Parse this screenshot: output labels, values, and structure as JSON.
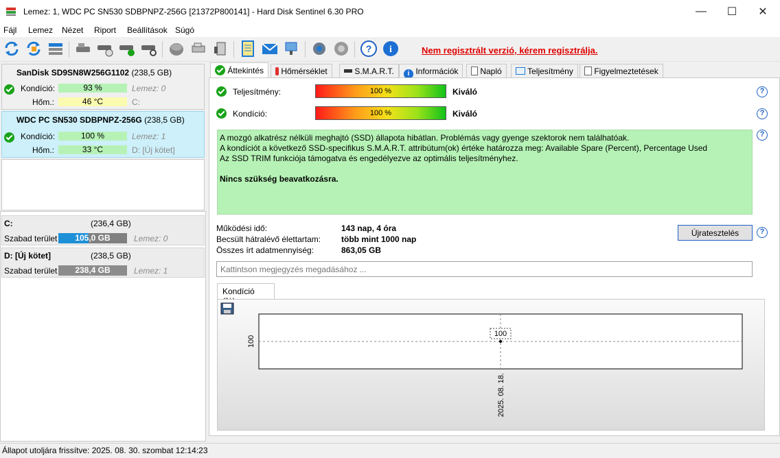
{
  "window": {
    "title": "Lemez: 1, WDC PC SN530 SDBPNPZ-256G [21372P800141]  -  Hard Disk Sentinel 6.30 PRO",
    "minimize": "—",
    "maximize": "☐",
    "close": "✕"
  },
  "menu": [
    "Fájl",
    "Lemez",
    "Nézet",
    "Riport",
    "Beállítások",
    "Súgó"
  ],
  "toolbar": {
    "register_link": "Nem regisztrált verzió, kérem regisztrálja."
  },
  "disks": [
    {
      "name": "SanDisk SD9SN8W256G1102",
      "size": "(238,5 GB)",
      "condition_label": "Kondíció:",
      "condition": "93 %",
      "condition_fraction": 0.93,
      "disk_ref": "Lemez: 0",
      "temp_label": "Hőm.:",
      "temp": "46 °C",
      "volumes": "C:"
    },
    {
      "name": "WDC PC SN530 SDBPNPZ-256G",
      "size": "(238,5 GB)",
      "condition_label": "Kondíció:",
      "condition": "100 %",
      "condition_fraction": 1.0,
      "disk_ref": "Lemez: 1",
      "temp_label": "Hőm.:",
      "temp": "33 °C",
      "volumes": "D: [Új kötet]"
    }
  ],
  "volumes": [
    {
      "name": "C:",
      "size": "(236,4 GB)",
      "free_label": "Szabad terület",
      "free": "105,0 GB",
      "disk_ref": "Lemez: 0"
    },
    {
      "name": "D: [Új kötet]",
      "size": "(238,5 GB)",
      "free_label": "Szabad terület",
      "free": "238,4 GB",
      "disk_ref": "Lemez: 1"
    }
  ],
  "tabs": [
    "Áttekintés",
    "Hőmérséklet",
    "S.M.A.R.T.",
    "Információk",
    "Napló",
    "Teljesítmény",
    "Figyelmeztetések"
  ],
  "overview": {
    "performance_label": "Teljesítmény:",
    "performance_value": "100 %",
    "performance_text": "Kiváló",
    "condition_label": "Kondíció:",
    "condition_value": "100 %",
    "condition_text": "Kiváló",
    "status_lines": [
      "A mozgó alkatrész nélküli meghajtó (SSD) állapota hibátlan. Problémás vagy gyenge szektorok nem találhatóak.",
      "A kondíciót a következő SSD-specifikus S.M.A.R.T. attribútum(ok) értéke határozza meg:  Available Spare (Percent), Percentage Used",
      "Az SSD TRIM funkciója támogatva és engedélyezve az optimális teljesítményhez."
    ],
    "status_action": "Nincs szükség beavatkozásra.",
    "uptime_label": "Működési idő:",
    "uptime": "143 nap, 4 óra",
    "lifetime_label": "Becsült hátralévő élettartam:",
    "lifetime": "több mint 1000 nap",
    "written_label": "Összes írt adatmennyiség:",
    "written": "863,05 GB",
    "retest_button": "Újratesztelés",
    "note_placeholder": "Kattintson megjegyzés megadásához ..."
  },
  "chart_tab": "Kondíció  (%)",
  "chart_data": {
    "type": "line",
    "x": [
      "2025. 08. 18."
    ],
    "series": [
      {
        "values": [
          100
        ]
      }
    ],
    "ylabel": "",
    "data_labels": [
      "100"
    ],
    "ytick": "100"
  },
  "statusbar": "Állapot utoljára frissítve: 2025. 08. 30. szombat 12:14:23",
  "colors": {
    "ok_green": "#19a319",
    "status_bg": "#b6f2b6",
    "register_red": "#e00000",
    "selected_disk": "#cdf0fa"
  }
}
